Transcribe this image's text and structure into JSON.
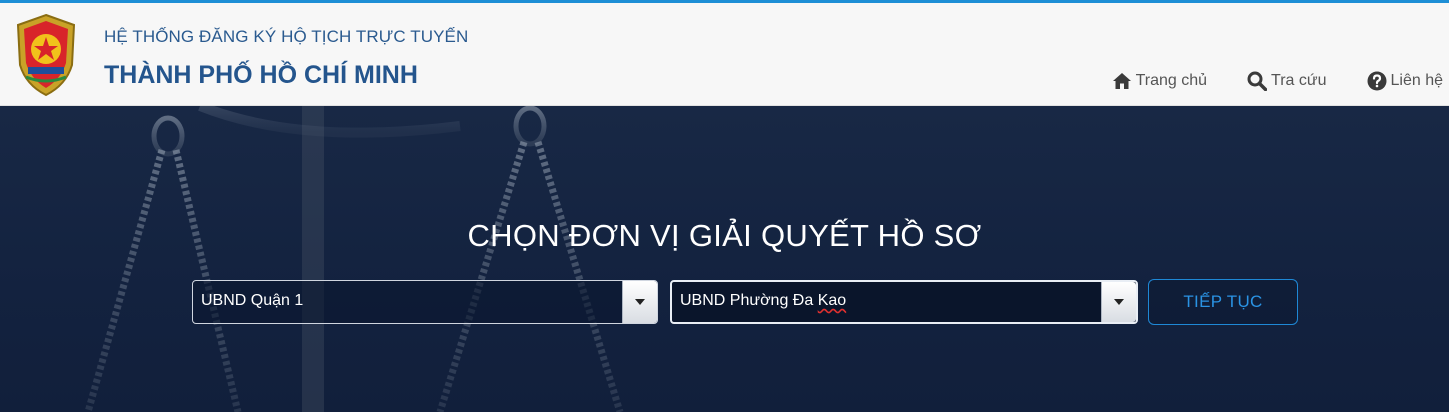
{
  "colors": {
    "accent": "#1e8fd6",
    "brand_text": "#24558d",
    "hero_bg": "#132240"
  },
  "header": {
    "title_line1": "HỆ THỐNG ĐĂNG KÝ HỘ TỊCH TRỰC TUYẾN",
    "title_line2": "THÀNH PHỐ HỒ CHÍ MINH",
    "logo_icon": "police-emblem-icon"
  },
  "nav": {
    "items": [
      {
        "label": "Trang chủ",
        "icon": "home-icon"
      },
      {
        "label": "Tra cứu",
        "icon": "search-icon"
      },
      {
        "label": "Liên hệ",
        "icon": "question-circle-icon"
      }
    ]
  },
  "hero": {
    "title": "CHỌN ĐƠN VỊ GIẢI QUYẾT HỒ SƠ",
    "district_select": {
      "value": "UBND Quận 1"
    },
    "ward_select": {
      "value_plain": "UBND Phường Đa ",
      "value_marked": "Kao"
    },
    "continue_label": "TIẾP TỤC"
  }
}
